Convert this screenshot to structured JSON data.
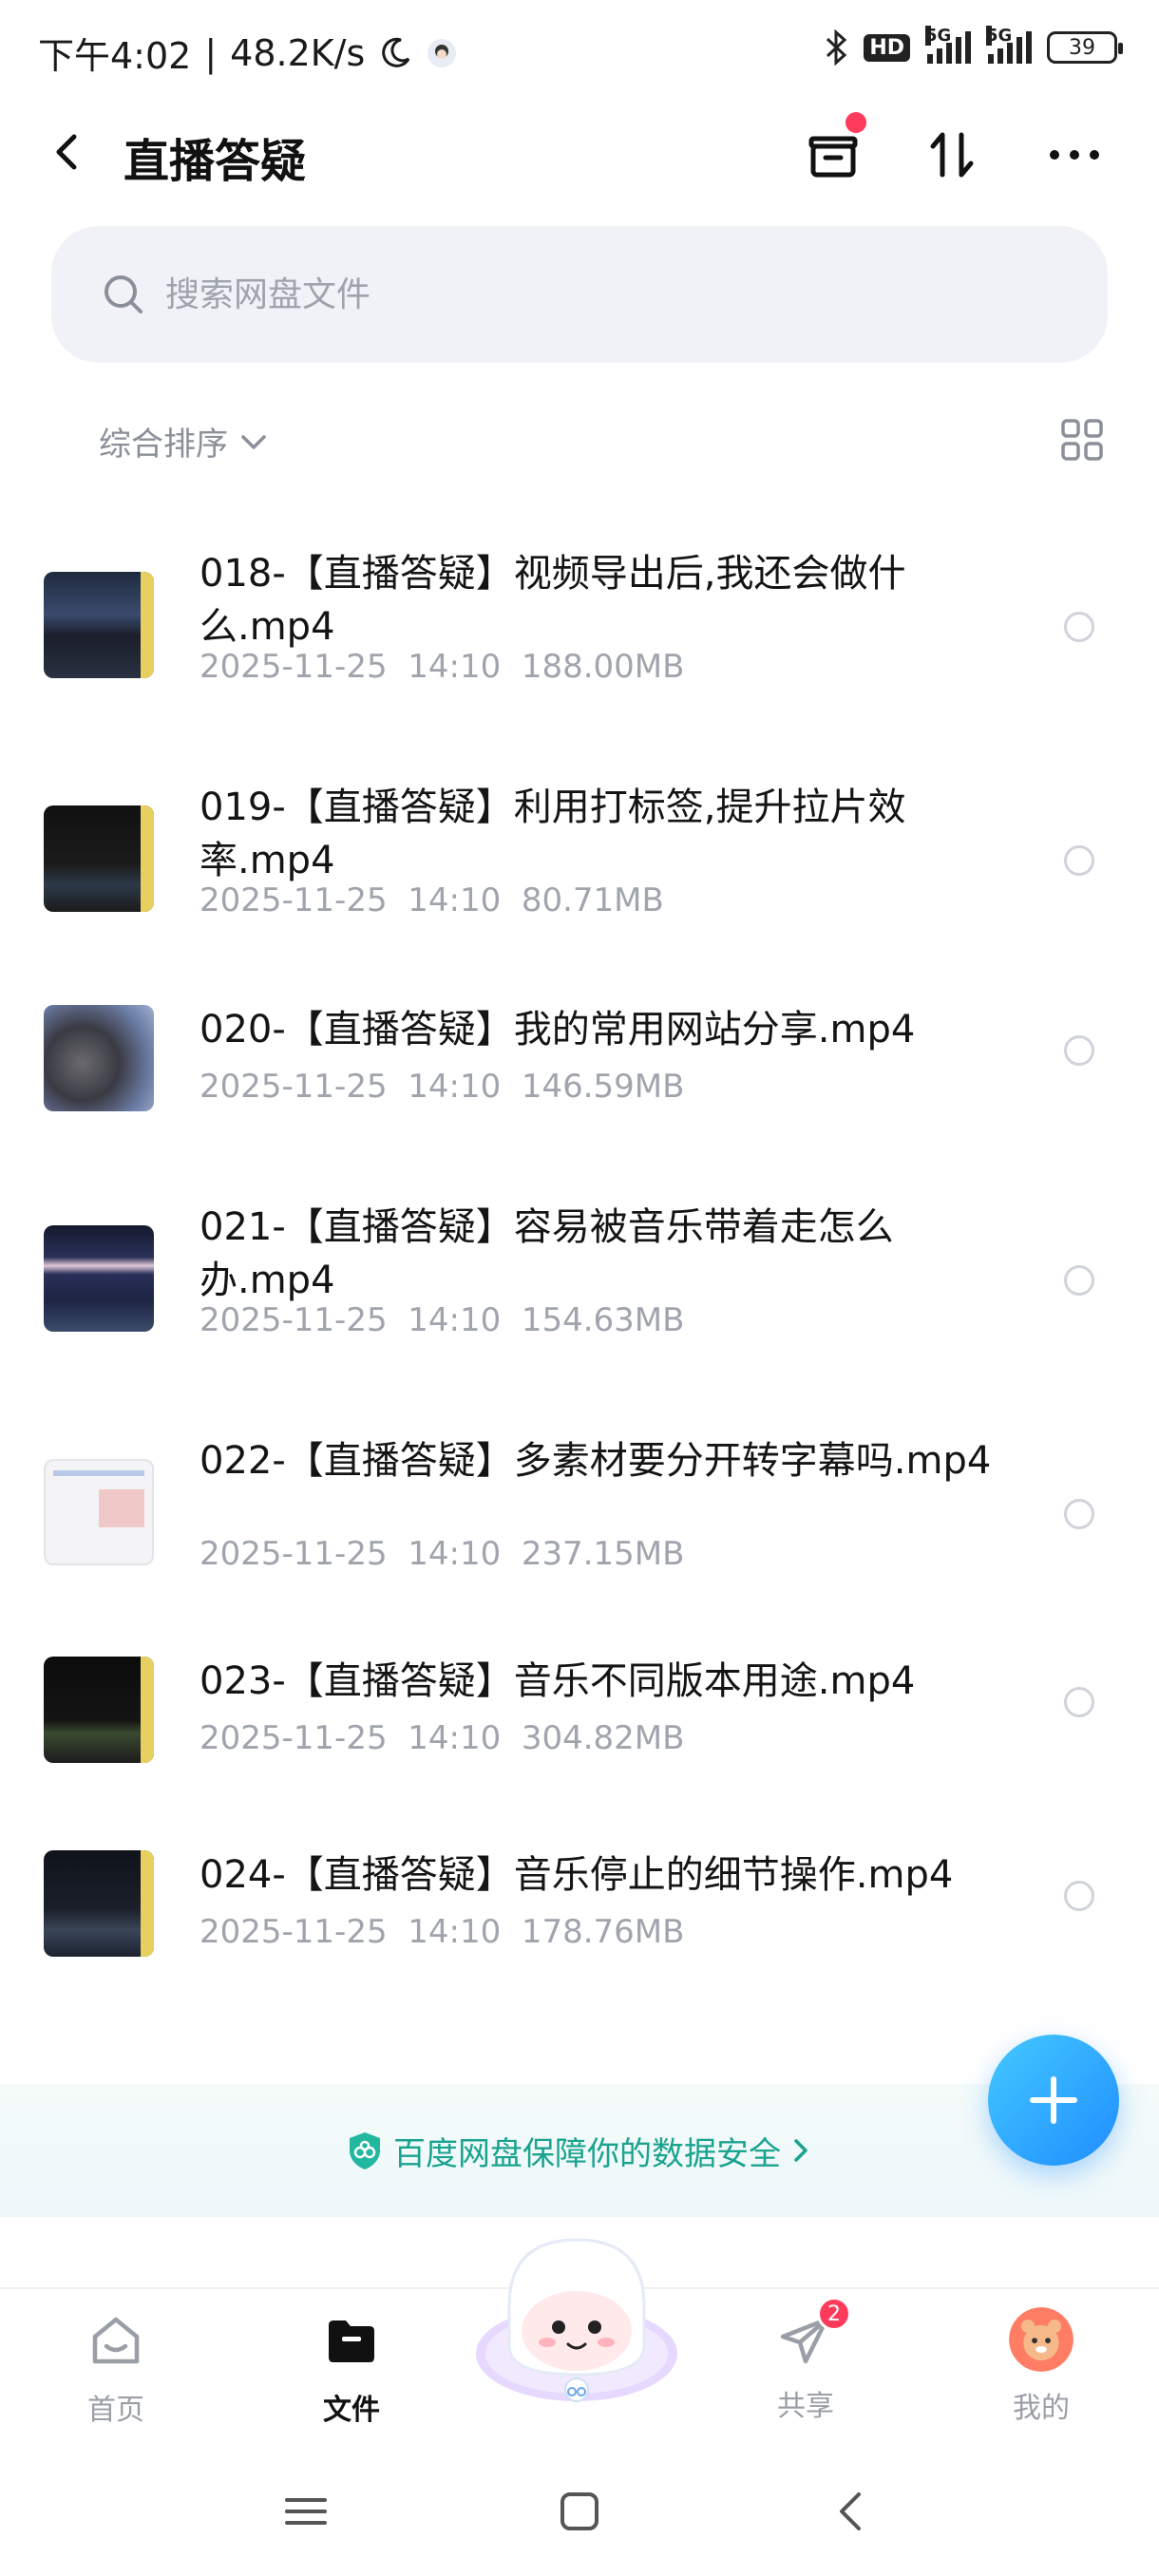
{
  "status_bar": {
    "time": "下午4:02",
    "speed": "48.2K/s",
    "hd": "HD",
    "net1": "5G",
    "net2": "5G",
    "battery": "39"
  },
  "header": {
    "title": "直播答疑"
  },
  "search": {
    "placeholder": "搜索网盘文件"
  },
  "sort": {
    "label": "综合排序"
  },
  "files": [
    {
      "name": "018-【直播答疑】视频导出后,我还会做什么.mp4",
      "date": "2025-11-25",
      "time": "14:10",
      "size": "188.00MB"
    },
    {
      "name": "019-【直播答疑】利用打标签,提升拉片效率.mp4",
      "date": "2025-11-25",
      "time": "14:10",
      "size": "80.71MB"
    },
    {
      "name": "020-【直播答疑】我的常用网站分享.mp4",
      "date": "2025-11-25",
      "time": "14:10",
      "size": "146.59MB"
    },
    {
      "name": "021-【直播答疑】容易被音乐带着走怎么办.mp4",
      "date": "2025-11-25",
      "time": "14:10",
      "size": "154.63MB"
    },
    {
      "name": "022-【直播答疑】多素材要分开转字幕吗.mp4",
      "date": "2025-11-25",
      "time": "14:10",
      "size": "237.15MB"
    },
    {
      "name": "023-【直播答疑】音乐不同版本用途.mp4",
      "date": "2025-11-25",
      "time": "14:10",
      "size": "304.82MB"
    },
    {
      "name": "024-【直播答疑】音乐停止的细节操作.mp4",
      "date": "2025-11-25",
      "time": "14:10",
      "size": "178.76MB"
    }
  ],
  "banner": {
    "text": "百度网盘保障你的数据安全"
  },
  "nav": {
    "home": "首页",
    "files": "文件",
    "share": "共享",
    "share_badge": "2",
    "mine": "我的"
  },
  "colors": {
    "accent": "#1f8dff",
    "badge": "#ff3b5c",
    "banner_text": "#1aa38f"
  }
}
